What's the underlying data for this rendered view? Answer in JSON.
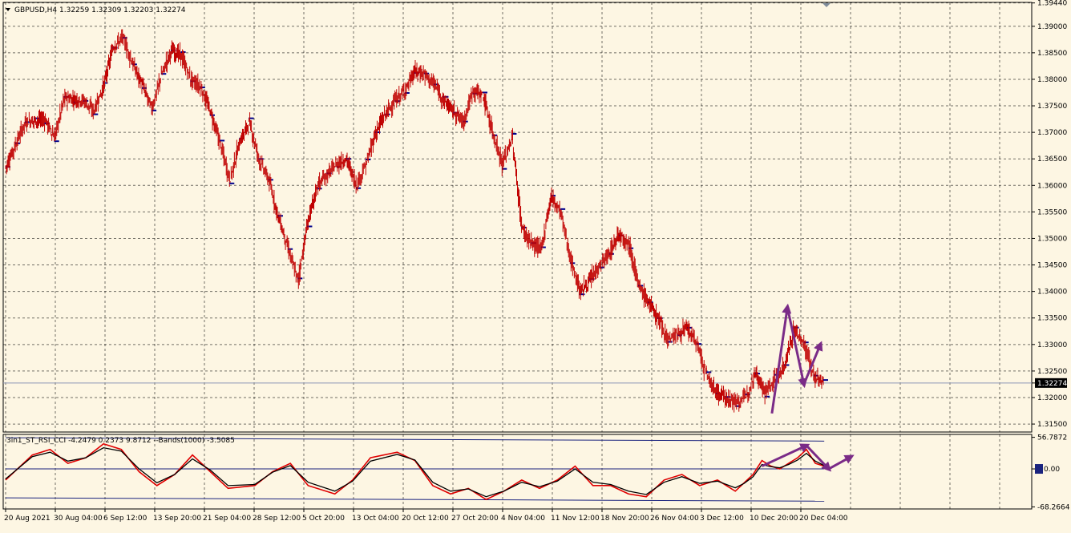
{
  "header": {
    "title": "GBPUSD,H4  1.32259 1.32309 1.32203 1.32274"
  },
  "indicator": {
    "label": "3in1_ST_RSI_CCI -4.2479 0.2373 9.8712  --Bands(1000) -3.5085"
  },
  "colors": {
    "background": "#fdf6e3",
    "candle": "#c00000",
    "marker": "#00008b",
    "arrow": "#7a2b87",
    "indicator_fast": "#e00000",
    "indicator_slow": "#000000",
    "band": "#1a237e"
  },
  "chart_data": [
    {
      "type": "bar",
      "title": "GBPUSD,H4  1.32259 1.32309 1.32203 1.32274",
      "price_axis": [
        "1.39440",
        "1.39000",
        "1.38500",
        "1.38000",
        "1.37500",
        "1.37000",
        "1.36500",
        "1.36000",
        "1.35500",
        "1.35000",
        "1.34500",
        "1.34000",
        "1.33500",
        "1.33000",
        "1.32500",
        "1.32274",
        "1.32000",
        "1.31500"
      ],
      "ylim": [
        1.3135,
        1.3945
      ],
      "time_axis": [
        "20 Aug 2021",
        "30 Aug 04:00",
        "6 Sep 12:00",
        "13 Sep 20:00",
        "21 Sep 04:00",
        "28 Sep 12:00",
        "5 Oct 20:00",
        "13 Oct 04:00",
        "20 Oct 12:00",
        "27 Oct 20:00",
        "4 Nov 04:00",
        "11 Nov 12:00",
        "18 Nov 20:00",
        "26 Nov 04:00",
        "3 Dec 12:00",
        "10 Dec 20:00",
        "20 Dec 04:00"
      ],
      "current_price": 1.32274,
      "close_path": [
        [
          0,
          1.3635
        ],
        [
          2,
          1.372
        ],
        [
          4,
          1.3725
        ],
        [
          5,
          1.369
        ],
        [
          6,
          1.3765
        ],
        [
          8,
          1.376
        ],
        [
          9,
          1.374
        ],
        [
          10,
          1.3785
        ],
        [
          11,
          1.386
        ],
        [
          12,
          1.388
        ],
        [
          13,
          1.383
        ],
        [
          14,
          1.379
        ],
        [
          15,
          1.3745
        ],
        [
          16,
          1.381
        ],
        [
          17,
          1.3855
        ],
        [
          18,
          1.3845
        ],
        [
          19,
          1.38
        ],
        [
          20,
          1.3785
        ],
        [
          21,
          1.374
        ],
        [
          22,
          1.368
        ],
        [
          23,
          1.361
        ],
        [
          24,
          1.368
        ],
        [
          25,
          1.372
        ],
        [
          26,
          1.365
        ],
        [
          27,
          1.361
        ],
        [
          28,
          1.354
        ],
        [
          29,
          1.348
        ],
        [
          30,
          1.342
        ],
        [
          31,
          1.353
        ],
        [
          32,
          1.36
        ],
        [
          33,
          1.362
        ],
        [
          34,
          1.364
        ],
        [
          35,
          1.365
        ],
        [
          36,
          1.36
        ],
        [
          37,
          1.364
        ],
        [
          38,
          1.37
        ],
        [
          39,
          1.3735
        ],
        [
          40,
          1.376
        ],
        [
          41,
          1.378
        ],
        [
          42,
          1.3815
        ],
        [
          43,
          1.381
        ],
        [
          44,
          1.379
        ],
        [
          45,
          1.376
        ],
        [
          46,
          1.374
        ],
        [
          47,
          1.372
        ],
        [
          48,
          1.378
        ],
        [
          49,
          1.377
        ],
        [
          50,
          1.37
        ],
        [
          51,
          1.364
        ],
        [
          52,
          1.369
        ],
        [
          53,
          1.352
        ],
        [
          54,
          1.349
        ],
        [
          55,
          1.348
        ],
        [
          56,
          1.358
        ],
        [
          57,
          1.355
        ],
        [
          58,
          1.346
        ],
        [
          59,
          1.34
        ],
        [
          60,
          1.342
        ],
        [
          61,
          1.345
        ],
        [
          62,
          1.347
        ],
        [
          63,
          1.351
        ],
        [
          64,
          1.349
        ],
        [
          65,
          1.341
        ],
        [
          66,
          1.338
        ],
        [
          67,
          1.335
        ],
        [
          68,
          1.331
        ],
        [
          69,
          1.332
        ],
        [
          70,
          1.333
        ],
        [
          71,
          1.33
        ],
        [
          72,
          1.324
        ],
        [
          73,
          1.321
        ],
        [
          74,
          1.32
        ],
        [
          75,
          1.319
        ],
        [
          76,
          1.32
        ],
        [
          77,
          1.325
        ],
        [
          78,
          1.321
        ],
        [
          79,
          1.3235
        ],
        [
          80,
          1.326
        ],
        [
          81,
          1.333
        ],
        [
          82,
          1.33
        ],
        [
          83,
          1.324
        ],
        [
          84,
          1.3227
        ]
      ],
      "projection": {
        "arrow_1": [
          [
            79,
            1.317
          ],
          [
            80.6,
            1.337
          ]
        ],
        "arrow_2": [
          [
            80.6,
            1.337
          ],
          [
            82.3,
            1.3225
          ]
        ],
        "arrow_3": [
          [
            82.3,
            1.3225
          ],
          [
            84.0,
            1.33
          ]
        ]
      }
    },
    {
      "type": "line",
      "title": "3in1_ST_RSI_CCI",
      "value_axis": [
        "56.7872",
        "0.00",
        "-68.2664"
      ],
      "ylim": [
        -72,
        62
      ],
      "series": [
        {
          "name": "3in1_ST_RSI_CCI",
          "values": [
            [
              0,
              -20
            ],
            [
              3,
              25
            ],
            [
              5,
              35
            ],
            [
              7,
              10
            ],
            [
              9,
              20
            ],
            [
              11,
              45
            ],
            [
              13,
              35
            ],
            [
              15,
              -5
            ],
            [
              17,
              -30
            ],
            [
              19,
              -10
            ],
            [
              21,
              25
            ],
            [
              23,
              -5
            ],
            [
              25,
              -35
            ],
            [
              28,
              -30
            ],
            [
              30,
              -5
            ],
            [
              32,
              10
            ],
            [
              34,
              -30
            ],
            [
              37,
              -45
            ],
            [
              39,
              -20
            ],
            [
              41,
              20
            ],
            [
              44,
              30
            ],
            [
              46,
              15
            ],
            [
              48,
              -30
            ],
            [
              50,
              -45
            ],
            [
              52,
              -35
            ],
            [
              54,
              -55
            ],
            [
              56,
              -40
            ],
            [
              58,
              -20
            ],
            [
              60,
              -35
            ],
            [
              62,
              -20
            ],
            [
              64,
              5
            ],
            [
              66,
              -30
            ],
            [
              68,
              -30
            ],
            [
              70,
              -45
            ],
            [
              72,
              -50
            ],
            [
              74,
              -20
            ],
            [
              76,
              -10
            ],
            [
              78,
              -30
            ],
            [
              80,
              -20
            ],
            [
              82,
              -40
            ],
            [
              83,
              -25
            ],
            [
              84,
              -10
            ],
            [
              85,
              15
            ],
            [
              86,
              5
            ],
            [
              87,
              0
            ],
            [
              88,
              10
            ],
            [
              89,
              20
            ],
            [
              90,
              35
            ],
            [
              91,
              10
            ],
            [
              92,
              5
            ]
          ]
        },
        {
          "values": [
            [
              0,
              -18
            ],
            [
              3,
              22
            ],
            [
              5,
              30
            ],
            [
              7,
              14
            ],
            [
              9,
              20
            ],
            [
              11,
              38
            ],
            [
              13,
              32
            ],
            [
              15,
              0
            ],
            [
              17,
              -25
            ],
            [
              19,
              -10
            ],
            [
              21,
              18
            ],
            [
              23,
              -2
            ],
            [
              25,
              -30
            ],
            [
              28,
              -28
            ],
            [
              30,
              -6
            ],
            [
              32,
              6
            ],
            [
              34,
              -24
            ],
            [
              37,
              -40
            ],
            [
              39,
              -22
            ],
            [
              41,
              14
            ],
            [
              44,
              26
            ],
            [
              46,
              16
            ],
            [
              48,
              -24
            ],
            [
              50,
              -40
            ],
            [
              52,
              -36
            ],
            [
              54,
              -50
            ],
            [
              56,
              -40
            ],
            [
              58,
              -24
            ],
            [
              60,
              -32
            ],
            [
              62,
              -22
            ],
            [
              64,
              0
            ],
            [
              66,
              -24
            ],
            [
              68,
              -28
            ],
            [
              70,
              -40
            ],
            [
              72,
              -46
            ],
            [
              74,
              -24
            ],
            [
              76,
              -14
            ],
            [
              78,
              -26
            ],
            [
              80,
              -22
            ],
            [
              82,
              -34
            ],
            [
              83,
              -26
            ],
            [
              84,
              -14
            ],
            [
              85,
              8
            ],
            [
              86,
              4
            ],
            [
              87,
              2
            ],
            [
              88,
              8
            ],
            [
              89,
              16
            ],
            [
              90,
              28
            ],
            [
              91,
              14
            ],
            [
              92,
              6
            ]
          ]
        }
      ],
      "projection": {
        "arrow_1": [
          [
            85,
            5
          ],
          [
            90,
            42
          ]
        ],
        "arrow_2": [
          [
            90,
            42
          ],
          [
            92.5,
            0
          ]
        ],
        "arrow_3": [
          [
            92.5,
            0
          ],
          [
            95,
            22
          ]
        ]
      }
    }
  ]
}
